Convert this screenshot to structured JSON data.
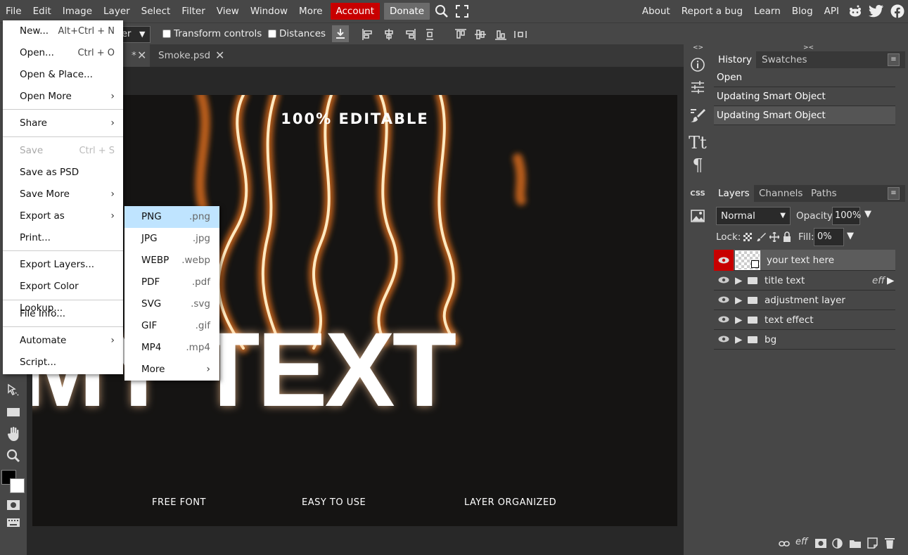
{
  "menubar": {
    "items": [
      "File",
      "Edit",
      "Image",
      "Layer",
      "Select",
      "Filter",
      "View",
      "Window",
      "More"
    ],
    "account": "Account",
    "donate": "Donate",
    "right_links": [
      "About",
      "Report a bug",
      "Learn",
      "Blog",
      "API"
    ]
  },
  "options": {
    "select_partial": "er",
    "transform_controls": "Transform controls",
    "distances": "Distances"
  },
  "tabs": [
    {
      "label": "*",
      "active": true
    },
    {
      "label": "Smoke.psd",
      "active": false
    }
  ],
  "file_menu": {
    "items": [
      {
        "label": "New...",
        "shortcut": "Alt+Ctrl + N"
      },
      {
        "label": "Open...",
        "shortcut": "Ctrl + O"
      },
      {
        "label": "Open & Place...",
        "shortcut": ""
      },
      {
        "label": "Open More",
        "shortcut": ""
      },
      {
        "label": "Share",
        "shortcut": ""
      },
      {
        "label": "Save",
        "shortcut": "Ctrl + S"
      },
      {
        "label": "Save as PSD",
        "shortcut": ""
      },
      {
        "label": "Save More",
        "shortcut": ""
      },
      {
        "label": "Export as",
        "shortcut": ""
      },
      {
        "label": "Print...",
        "shortcut": ""
      },
      {
        "label": "Export Layers...",
        "shortcut": ""
      },
      {
        "label": "Export Color Lookup...",
        "shortcut": ""
      },
      {
        "label": "File Info...",
        "shortcut": ""
      },
      {
        "label": "Automate",
        "shortcut": ""
      },
      {
        "label": "Script...",
        "shortcut": ""
      }
    ]
  },
  "export_menu": {
    "items": [
      {
        "label": "PNG",
        "ext": ".png"
      },
      {
        "label": "JPG",
        "ext": ".jpg"
      },
      {
        "label": "WEBP",
        "ext": ".webp"
      },
      {
        "label": "PDF",
        "ext": ".pdf"
      },
      {
        "label": "SVG",
        "ext": ".svg"
      },
      {
        "label": "GIF",
        "ext": ".gif"
      },
      {
        "label": "MP4",
        "ext": ".mp4"
      },
      {
        "label": "More",
        "ext": ""
      }
    ]
  },
  "artwork": {
    "title": "100% EDITABLE",
    "big_text": "MY TEXT",
    "footer": [
      "FREE FONT",
      "EASY TO USE",
      "LAYER ORGANIZED"
    ]
  },
  "history": {
    "tabs": [
      "History",
      "Swatches"
    ],
    "items": [
      "Open",
      "Updating Smart Object",
      "Updating Smart Object"
    ]
  },
  "layers": {
    "tabs": [
      "Layers",
      "Channels",
      "Paths"
    ],
    "blend_mode": "Normal",
    "opacity_label": "Opacity:",
    "opacity": "100%",
    "lock_label": "Lock:",
    "fill_label": "Fill:",
    "fill": "0%",
    "items": [
      {
        "name": "your text here",
        "selected": true,
        "eff": ""
      },
      {
        "name": "title text",
        "selected": false,
        "eff": "eff"
      },
      {
        "name": "adjustment layer",
        "selected": false,
        "eff": ""
      },
      {
        "name": "text effect",
        "selected": false,
        "eff": ""
      },
      {
        "name": "bg",
        "selected": false,
        "eff": ""
      }
    ]
  },
  "colors": {
    "account": "#c80000",
    "selected_layer_eye": "#c80000",
    "highlight": "#bfe4ff"
  }
}
